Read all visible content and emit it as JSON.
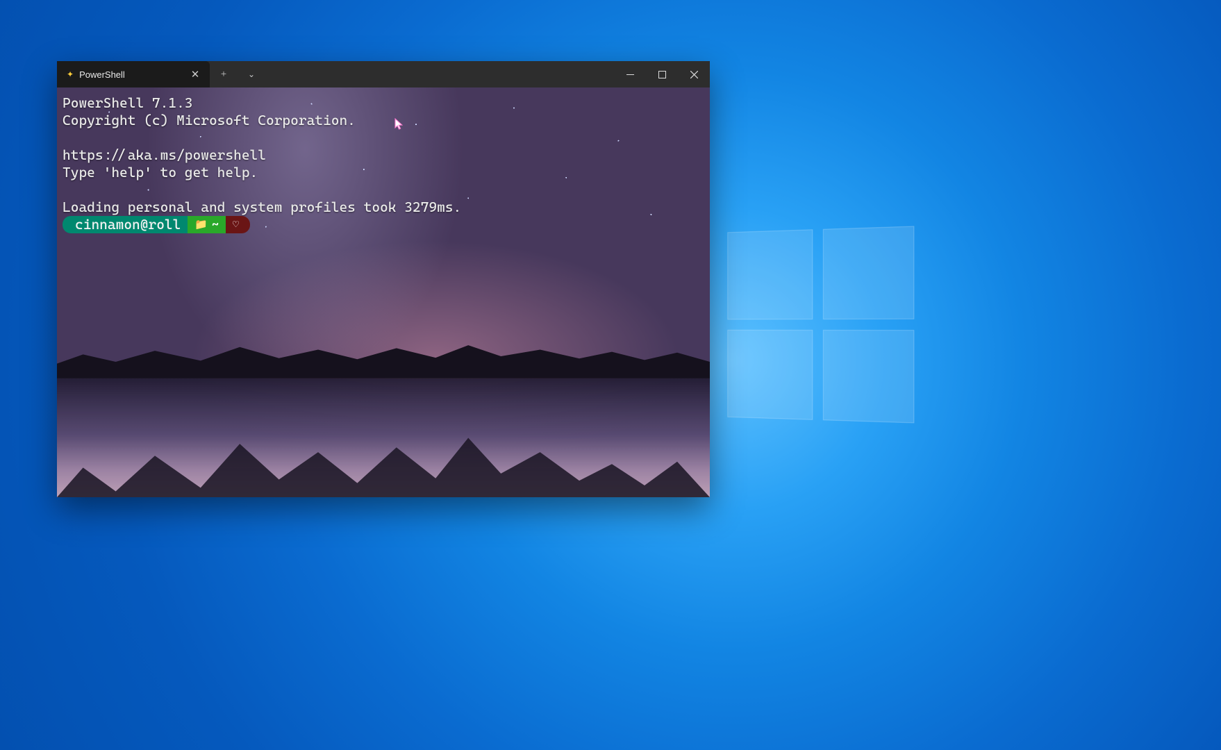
{
  "tab": {
    "label": "PowerShell",
    "icon": "sparkle-icon"
  },
  "terminal": {
    "lines": [
      "PowerShell 7.1.3",
      "Copyright (c) Microsoft Corporation.",
      "",
      "https://aka.ms/powershell",
      "Type 'help' to get help.",
      "",
      "Loading personal and system profiles took 3279ms."
    ],
    "prompt": {
      "user": "cinnamon@roll",
      "path_icon": "folder-icon",
      "path": "~",
      "status_icon": "heart-icon"
    }
  },
  "icons": {
    "plus": "+",
    "chevron": "⌄",
    "close": "✕",
    "folder": "📁",
    "heart": "♡",
    "tilde": "~",
    "sparkle": "✦"
  }
}
